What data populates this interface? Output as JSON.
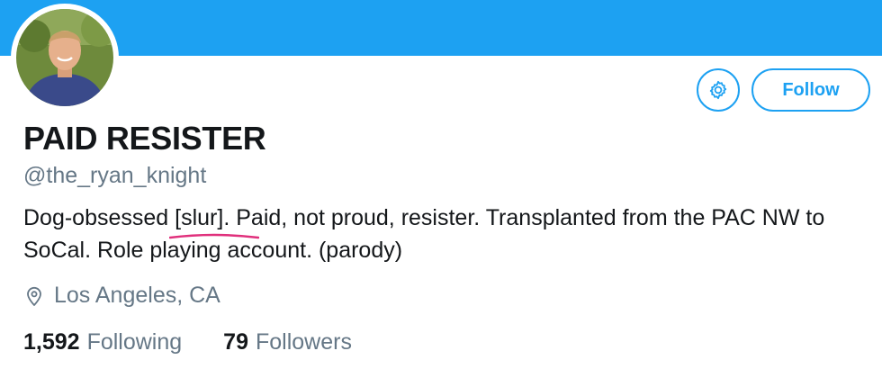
{
  "colors": {
    "accent": "#1da1f2",
    "text_primary": "#14171a",
    "text_secondary": "#657786",
    "spellcheck_underline": "#e0307c"
  },
  "profile": {
    "display_name": "PAID RESISTER",
    "handle": "@the_ryan_knight",
    "bio": {
      "before_flagged": "Dog-obsessed ",
      "flagged_word": "[slur]",
      "after_flagged": ". Paid, not proud, resister. Transplanted from the PAC NW to SoCal. Role playing account. (parody)"
    },
    "location": {
      "icon": "location-pin-icon",
      "text": "Los Angeles, CA"
    },
    "stats": {
      "following": {
        "count": "1,592",
        "label": "Following"
      },
      "followers": {
        "count": "79",
        "label": "Followers"
      }
    }
  },
  "actions": {
    "settings_icon": "gear-icon",
    "follow_label": "Follow"
  }
}
